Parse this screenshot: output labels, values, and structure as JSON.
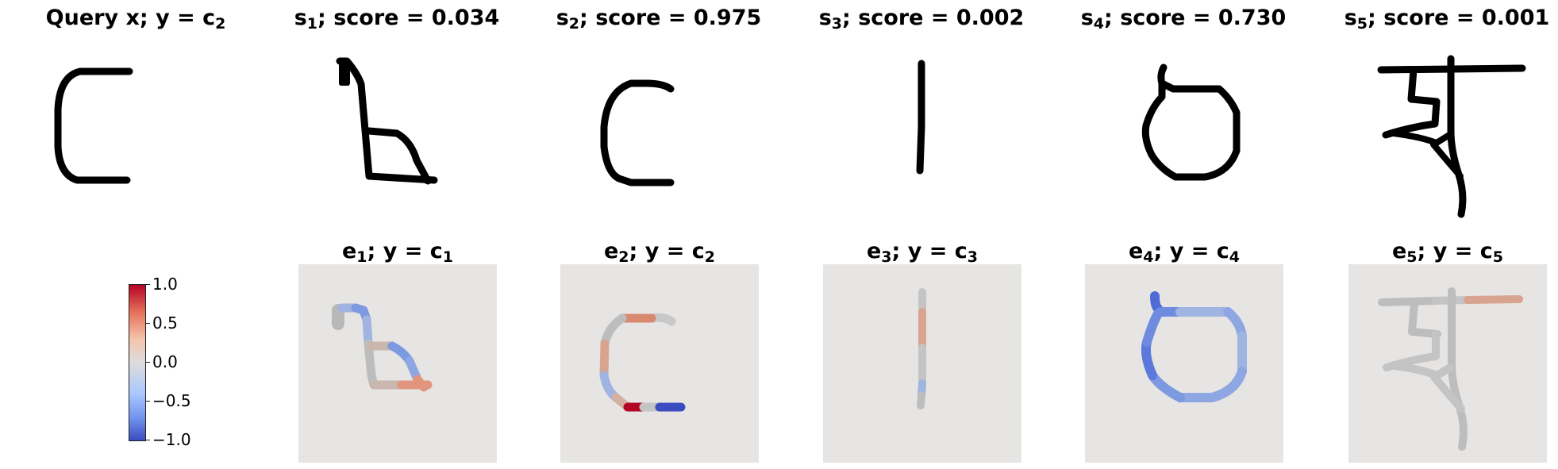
{
  "query": {
    "label": "Query x; y = ",
    "class_sym": "c",
    "class_idx": "2"
  },
  "support": [
    {
      "sym": "s",
      "idx": "1",
      "score_label": "; score = 0.034",
      "score": 0.034
    },
    {
      "sym": "s",
      "idx": "2",
      "score_label": "; score = 0.975",
      "score": 0.975
    },
    {
      "sym": "s",
      "idx": "3",
      "score_label": "; score = 0.002",
      "score": 0.002
    },
    {
      "sym": "s",
      "idx": "4",
      "score_label": "; score = 0.730",
      "score": 0.73
    },
    {
      "sym": "s",
      "idx": "5",
      "score_label": "; score = 0.001",
      "score": 0.001
    }
  ],
  "explanations": [
    {
      "sym": "e",
      "idx": "1",
      "mid": "; y = ",
      "csym": "c",
      "cidx": "1"
    },
    {
      "sym": "e",
      "idx": "2",
      "mid": "; y = ",
      "csym": "c",
      "cidx": "2"
    },
    {
      "sym": "e",
      "idx": "3",
      "mid": "; y = ",
      "csym": "c",
      "cidx": "3"
    },
    {
      "sym": "e",
      "idx": "4",
      "mid": "; y = ",
      "csym": "c",
      "cidx": "4"
    },
    {
      "sym": "e",
      "idx": "5",
      "mid": "; y = ",
      "csym": "c",
      "cidx": "5"
    }
  ],
  "colorbar": {
    "ticks": [
      "1.0",
      "0.5",
      "0.0",
      "−0.5",
      "−1.0"
    ],
    "vmin": -1.0,
    "vmax": 1.0,
    "colors": {
      "low": "#3b4cc0",
      "mid": "#dddddd",
      "high": "#b40426"
    }
  }
}
